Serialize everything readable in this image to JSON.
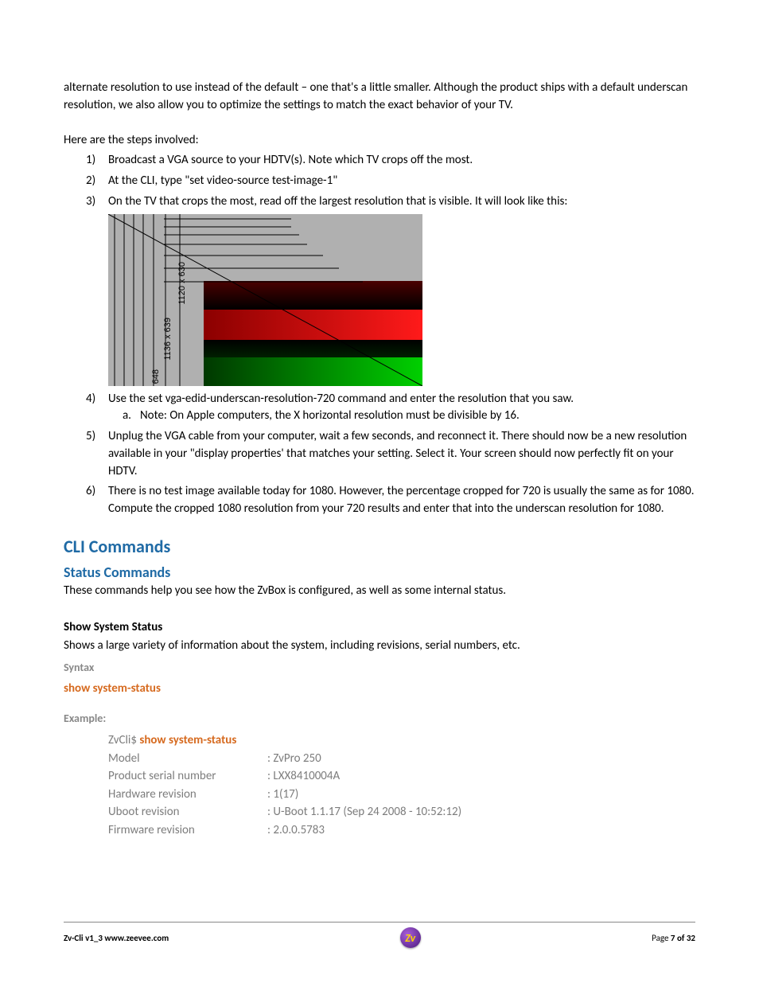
{
  "intro": "alternate resolution to use instead of the default – one that's a little smaller.   Although the product ships with a default  underscan resolution, we also allow you to optimize the settings to match the exact behavior of your TV.",
  "steps_lead": "Here are the steps involved:",
  "steps": {
    "s1": "Broadcast  a VGA source to your HDTV(s).  Note which TV crops off the most.",
    "s2": "At the CLI, type \"set video-source  test-image-1\"",
    "s3": "On the TV that crops the most, read off the largest resolution that is visible.  It will look like this:",
    "s4": "Use the set vga-edid-underscan-resolution-720 command and enter the resolution that you saw.",
    "s4a": "Note: On Apple computers, the X horizontal resolution must be divisible by 16.",
    "s5": " Unplug the VGA cable from your computer, wait a few seconds, and reconnect it.    There should now be a new resolution available in your \"display properties' that matches your setting.   Select it.  Your screen should now perfectly fit on your HDTV.",
    "s6": "There is no test image available today for 1080.  However, the percentage cropped for 720 is usually the same as for 1080.   Compute the cropped 1080 resolution from your 720 results and enter that into the underscan resolution for 1080."
  },
  "test_image_labels": {
    "l1": "1120 x 630",
    "l2": "1136 x 639",
    "l3": "648"
  },
  "headings": {
    "cli": "CLI Commands",
    "status": "Status Commands"
  },
  "status_desc": "These commands help you see how the ZvBox is configured, as well as some internal status.",
  "show_system": {
    "title": "Show System Status",
    "desc": "Shows a large variety of information about the system, including revisions, serial numbers, etc.",
    "syntax_label": "Syntax",
    "syntax_cmd": "show system-status",
    "example_label": "Example:",
    "prompt": "ZvCli$ ",
    "cmd": "show system-status",
    "rows": [
      {
        "k": "Model",
        "v": ": ZvPro 250"
      },
      {
        "k": "Product serial number",
        "v": ": LXX8410004A"
      },
      {
        "k": "Hardware revision",
        "v": ": 1(17)"
      },
      {
        "k": "Uboot revision",
        "v": ": U-Boot 1.1.17 (Sep 24 2008 - 10:52:12)"
      },
      {
        "k": "Firmware revision",
        "v": ": 2.0.0.5783"
      }
    ]
  },
  "footer": {
    "left": "Zv-Cli  v1_3    www.zeevee.com",
    "page_word": "Page ",
    "page_num": "7 of 32",
    "logo": "Zv"
  }
}
